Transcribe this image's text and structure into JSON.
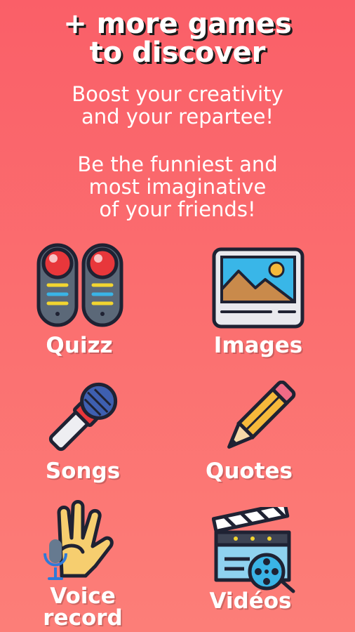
{
  "headline": {
    "line1": "+ more games",
    "line2": "to discover"
  },
  "subtitle1": {
    "line1": "Boost your creativity",
    "line2": "and your repartee!"
  },
  "subtitle2": {
    "line1": "Be the funniest and",
    "line2": "most imaginative",
    "line3": "of your friends!"
  },
  "games": [
    {
      "label": "Quizz",
      "icon": "buzzer-icon"
    },
    {
      "label": "Images",
      "icon": "picture-icon"
    },
    {
      "label": "Songs",
      "icon": "microphone-icon"
    },
    {
      "label": "Quotes",
      "icon": "pencil-icon"
    },
    {
      "label_line1": "Voice",
      "label_line2": "record",
      "icon": "hand-microphone-icon"
    },
    {
      "label": "Vidéos",
      "icon": "clapperboard-icon"
    }
  ],
  "colors": {
    "background_top": "#fa5f68",
    "background_bottom": "#fc7e78",
    "text": "#ffffff"
  }
}
